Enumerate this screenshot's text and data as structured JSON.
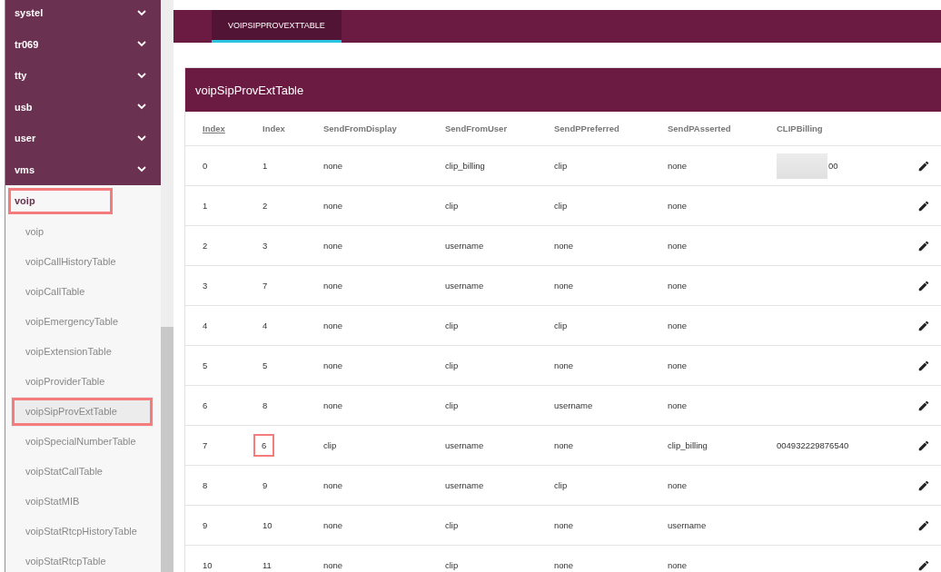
{
  "sidebar": {
    "groups": [
      {
        "label": "systel",
        "expanded": false
      },
      {
        "label": "tr069",
        "expanded": false
      },
      {
        "label": "tty",
        "expanded": false
      },
      {
        "label": "usb",
        "expanded": false
      },
      {
        "label": "user",
        "expanded": false
      },
      {
        "label": "vms",
        "expanded": false
      },
      {
        "label": "voip",
        "expanded": true,
        "highlighted": true,
        "children": [
          {
            "label": "voip",
            "selected": false,
            "highlighted": false
          },
          {
            "label": "voipCallHistoryTable",
            "selected": false,
            "highlighted": false
          },
          {
            "label": "voipCallTable",
            "selected": false,
            "highlighted": false
          },
          {
            "label": "voipEmergencyTable",
            "selected": false,
            "highlighted": false
          },
          {
            "label": "voipExtensionTable",
            "selected": false,
            "highlighted": false
          },
          {
            "label": "voipProviderTable",
            "selected": false,
            "highlighted": false
          },
          {
            "label": "voipSipProvExtTable",
            "selected": true,
            "highlighted": true
          },
          {
            "label": "voipSpecialNumberTable",
            "selected": false,
            "highlighted": false
          },
          {
            "label": "voipStatCallTable",
            "selected": false,
            "highlighted": false
          },
          {
            "label": "voipStatMIB",
            "selected": false,
            "highlighted": false
          },
          {
            "label": "voipStatRtcpHistoryTable",
            "selected": false,
            "highlighted": false
          },
          {
            "label": "voipStatRtcpTable",
            "selected": false,
            "highlighted": false
          }
        ]
      }
    ]
  },
  "tabs": [
    {
      "label": "VOIPSIPPROVEXTTABLE",
      "selected": true
    }
  ],
  "card": {
    "title": "voipSipProvExtTable"
  },
  "table": {
    "columns": [
      {
        "label": "Index",
        "sortable": true
      },
      {
        "label": "Index",
        "sortable": false
      },
      {
        "label": "SendFromDisplay",
        "sortable": false
      },
      {
        "label": "SendFromUser",
        "sortable": false
      },
      {
        "label": "SendPPreferred",
        "sortable": false
      },
      {
        "label": "SendPAsserted",
        "sortable": false
      },
      {
        "label": "CLIPBilling",
        "sortable": false
      }
    ],
    "rows": [
      {
        "cells": [
          "0",
          "1",
          "none",
          "clip_billing",
          "clip",
          "none"
        ],
        "clip_billing": "00",
        "billing_redacted": true,
        "index_highlighted": false
      },
      {
        "cells": [
          "1",
          "2",
          "none",
          "clip",
          "clip",
          "none"
        ],
        "index_highlighted": false
      },
      {
        "cells": [
          "2",
          "3",
          "none",
          "username",
          "none",
          "none"
        ],
        "index_highlighted": false
      },
      {
        "cells": [
          "3",
          "7",
          "none",
          "username",
          "none",
          "none"
        ],
        "index_highlighted": false
      },
      {
        "cells": [
          "4",
          "4",
          "none",
          "clip",
          "clip",
          "none"
        ],
        "index_highlighted": false
      },
      {
        "cells": [
          "5",
          "5",
          "none",
          "clip",
          "none",
          "none"
        ],
        "index_highlighted": false
      },
      {
        "cells": [
          "6",
          "8",
          "none",
          "clip",
          "username",
          "none"
        ],
        "index_highlighted": false
      },
      {
        "cells": [
          "7",
          "6",
          "clip",
          "username",
          "none",
          "clip_billing"
        ],
        "clip_billing": "004932229876540",
        "billing_redacted": false,
        "index_highlighted": true
      },
      {
        "cells": [
          "8",
          "9",
          "none",
          "username",
          "clip",
          "none"
        ],
        "index_highlighted": false
      },
      {
        "cells": [
          "9",
          "10",
          "none",
          "clip",
          "none",
          "username"
        ],
        "index_highlighted": false
      },
      {
        "cells": [
          "10",
          "11",
          "none",
          "clip",
          "none",
          "none"
        ],
        "index_highlighted": false
      }
    ]
  }
}
